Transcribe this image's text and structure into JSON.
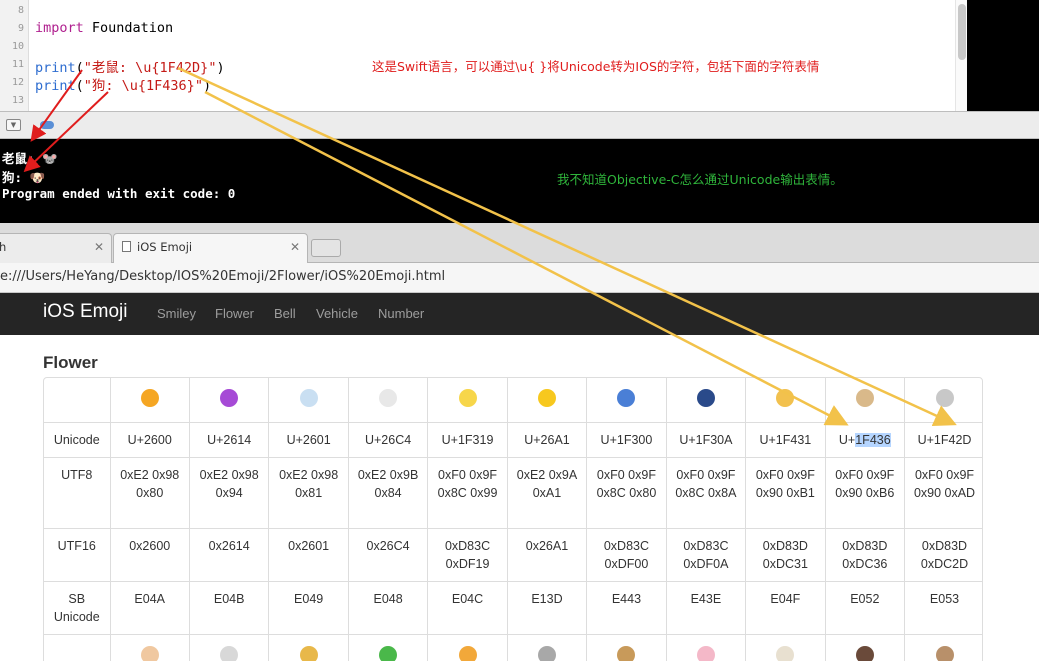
{
  "editor": {
    "lines": [
      {
        "num": "8",
        "parts": []
      },
      {
        "num": "9",
        "parts": [
          {
            "t": "import",
            "c": "kw"
          },
          {
            "t": " Foundation",
            "c": ""
          }
        ]
      },
      {
        "num": "10",
        "parts": []
      },
      {
        "num": "11",
        "parts": [
          {
            "t": "print",
            "c": "fn"
          },
          {
            "t": "(",
            "c": ""
          },
          {
            "t": "\"老鼠: \\u{1F42D}\"",
            "c": "str"
          },
          {
            "t": ")",
            "c": ""
          }
        ]
      },
      {
        "num": "12",
        "parts": [
          {
            "t": "print",
            "c": "fn"
          },
          {
            "t": "(",
            "c": ""
          },
          {
            "t": "\"狗: \\u{1F436}\"",
            "c": "str"
          },
          {
            "t": ")",
            "c": ""
          }
        ]
      },
      {
        "num": "13",
        "parts": []
      }
    ],
    "annotation": "这是Swift语言，可以通过\\u{ }将Unicode转为IOS的字符，包括下面的字符表情"
  },
  "console": {
    "lines": [
      "老鼠: 🐭",
      "狗: 🐶",
      "Program ended with exit code: 0"
    ],
    "annotation": "我不知道Objective-C怎么通过Unicode输出表情。"
  },
  "browser": {
    "tabs": [
      {
        "label": "h",
        "active": false
      },
      {
        "label": "iOS Emoji",
        "active": true
      }
    ],
    "url": "e:///Users/HeYang/Desktop/IOS%20Emoji/2Flower/iOS%20Emoji.html"
  },
  "page": {
    "brand": "iOS Emoji",
    "nav": [
      "Smiley",
      "Flower",
      "Bell",
      "Vehicle",
      "Number"
    ],
    "section": "Flower",
    "row_labels": {
      "unicode": "Unicode",
      "utf8": "UTF8",
      "utf16": "UTF16",
      "sb": "SB Unicode"
    },
    "columns": [
      {
        "emoji": "sun-emoji",
        "color": "#f5a623",
        "unicode": "U+2600",
        "utf8": "0xE2 0x98 0x80",
        "utf16": "0x2600",
        "sb": "E04A"
      },
      {
        "emoji": "umbrella-rain-emoji",
        "color": "#a64ad6",
        "unicode": "U+2614",
        "utf8": "0xE2 0x98 0x94",
        "utf16": "0x2614",
        "sb": "E04B"
      },
      {
        "emoji": "cloud-emoji",
        "color": "#c9dff2",
        "unicode": "U+2601",
        "utf8": "0xE2 0x98 0x81",
        "utf16": "0x2601",
        "sb": "E049"
      },
      {
        "emoji": "snowman-emoji",
        "color": "#e8e8e8",
        "unicode": "U+26C4",
        "utf8": "0xE2 0x9B 0x84",
        "utf16": "0x26C4",
        "sb": "E048"
      },
      {
        "emoji": "crescent-moon-emoji",
        "color": "#f7d64a",
        "unicode": "U+1F319",
        "utf8": "0xF0 0x9F 0x8C 0x99",
        "utf16": "0xD83C 0xDF19",
        "sb": "E04C"
      },
      {
        "emoji": "lightning-emoji",
        "color": "#f7c81e",
        "unicode": "U+26A1",
        "utf8": "0xE2 0x9A 0xA1",
        "utf16": "0x26A1",
        "sb": "E13D"
      },
      {
        "emoji": "cyclone-emoji",
        "color": "#4a7fd6",
        "unicode": "U+1F300",
        "utf8": "0xF0 0x9F 0x8C 0x80",
        "utf16": "0xD83C 0xDF00",
        "sb": "E443"
      },
      {
        "emoji": "wave-emoji",
        "color": "#2a4a8a",
        "unicode": "U+1F30A",
        "utf8": "0xF0 0x9F 0x8C 0x8A",
        "utf16": "0xD83C 0xDF0A",
        "sb": "E43E"
      },
      {
        "emoji": "cat-face-emoji",
        "color": "#f2c14e",
        "unicode": "U+1F431",
        "utf8": "0xF0 0x9F 0x90 0xB1",
        "utf16": "0xD83D 0xDC31",
        "sb": "E04F"
      },
      {
        "emoji": "dog-face-emoji",
        "color": "#d9b98a",
        "unicode": "U+1F436",
        "utf8": "0xF0 0x9F 0x90 0xB6",
        "utf16": "0xD83D 0xDC36",
        "sb": "E052",
        "highlight": "1F436",
        "prefix": "U+"
      },
      {
        "emoji": "mouse-face-emoji",
        "color": "#c8c8c8",
        "unicode": "U+1F42D",
        "utf8": "0xF0 0x9F 0x90 0xAD",
        "utf16": "0xD83D 0xDC2D",
        "sb": "E053"
      }
    ],
    "next_row_emojis": [
      {
        "name": "hamster-emoji",
        "color": "#f0c8a0"
      },
      {
        "name": "rabbit-emoji",
        "color": "#d8d8d8"
      },
      {
        "name": "wolf-emoji",
        "color": "#e8b84a"
      },
      {
        "name": "frog-emoji",
        "color": "#4ab84a"
      },
      {
        "name": "tiger-emoji",
        "color": "#f2a83a"
      },
      {
        "name": "koala-emoji",
        "color": "#a8a8a8"
      },
      {
        "name": "bear-emoji",
        "color": "#c89a5a"
      },
      {
        "name": "pig-emoji",
        "color": "#f4b8c8"
      },
      {
        "name": "cow-emoji",
        "color": "#e8e0d0"
      },
      {
        "name": "boar-emoji",
        "color": "#6a4a3a"
      },
      {
        "name": "monkey-emoji",
        "color": "#b8906a"
      }
    ]
  }
}
